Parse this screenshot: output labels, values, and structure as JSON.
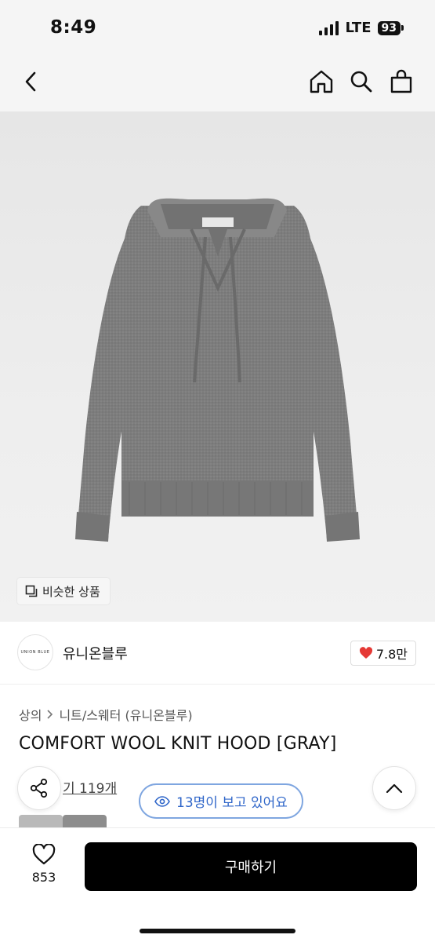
{
  "status_bar": {
    "time": "8:49",
    "network": "LTE",
    "battery": "93"
  },
  "nav": {
    "back_icon": "chevron-left-icon",
    "home_icon": "home-icon",
    "search_icon": "search-icon",
    "bag_icon": "shopping-bag-icon"
  },
  "hero": {
    "similar_label": "비슷한 상품"
  },
  "brand": {
    "logo_text": "UNION BLUE",
    "name": "유니온블루",
    "likes": "7.8만",
    "like_color": "#e53935"
  },
  "product": {
    "breadcrumb": [
      "상의",
      "니트/스웨터 (유니온블루)"
    ],
    "title": "COMFORT WOOL KNIT HOOD [GRAY]",
    "review_text": "기 119개"
  },
  "viewers": {
    "text": "13명이 보고 있어요",
    "color": "#2f66c9"
  },
  "bottom": {
    "wish_count": "853",
    "buy_label": "구매하기"
  }
}
